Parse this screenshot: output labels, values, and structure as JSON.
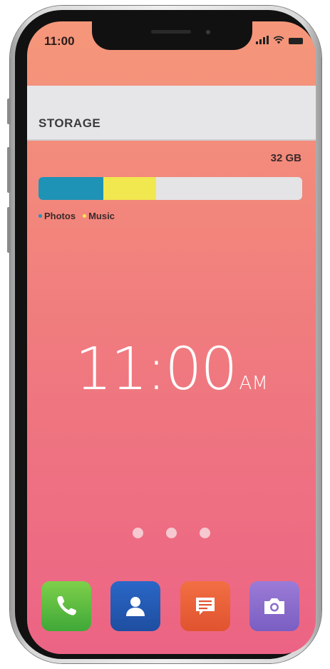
{
  "status_bar": {
    "time": "11:00",
    "icons": [
      "signal-icon",
      "wifi-icon",
      "battery-icon"
    ]
  },
  "storage": {
    "title": "STORAGE",
    "capacity": "32 GB",
    "usage": [
      {
        "name": "Photos",
        "fraction": 0.245,
        "color": "#1f93b5"
      },
      {
        "name": "Music",
        "fraction": 0.2,
        "color": "#f0e84e"
      }
    ],
    "legend": [
      {
        "label": "Photos",
        "color": "#1f93b5"
      },
      {
        "label": "Music",
        "color": "#f0e84e"
      }
    ]
  },
  "lock_clock": {
    "time": "11:00",
    "ampm": "AM"
  },
  "page_indicator": {
    "count": 3
  },
  "dock": {
    "apps": [
      {
        "name": "phone-icon",
        "color_top": "#7ed04a",
        "color_bottom": "#3fa838"
      },
      {
        "name": "contacts-icon",
        "color_top": "#2a67c7",
        "color_bottom": "#1e4ea0"
      },
      {
        "name": "messages-icon",
        "color_top": "#f26f43",
        "color_bottom": "#e0532f"
      },
      {
        "name": "camera-icon",
        "color_top": "#9b7bd6",
        "color_bottom": "#7a5ec2"
      }
    ]
  }
}
